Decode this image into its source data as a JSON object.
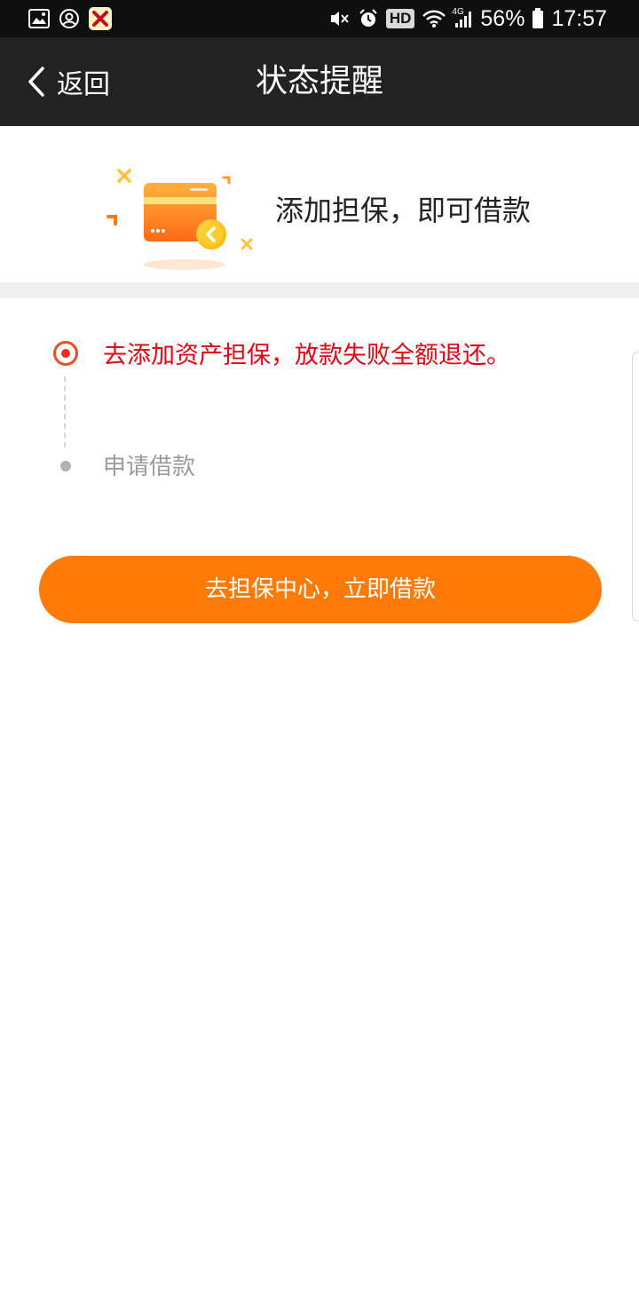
{
  "status_bar": {
    "battery_percent": "56%",
    "time": "17:57",
    "hd_label": "HD",
    "network_label": "4G",
    "icons": [
      "gallery-icon",
      "account-icon",
      "app-icon",
      "mute-icon",
      "alarm-icon",
      "hd-icon",
      "wifi-icon",
      "signal-icon",
      "battery-icon"
    ]
  },
  "nav": {
    "back_label": "返回",
    "title": "状态提醒"
  },
  "hero": {
    "message": "添加担保，即可借款",
    "icon": "card-illustration-icon"
  },
  "steps": [
    {
      "label": "去添加资产担保，放款失败全额退还。",
      "active": true,
      "color": "#e60012"
    },
    {
      "label": "申请借款",
      "active": false,
      "color": "#9b9b9b"
    }
  ],
  "cta": {
    "label": "去担保中心，立即借款",
    "color": "#ff7a07"
  }
}
